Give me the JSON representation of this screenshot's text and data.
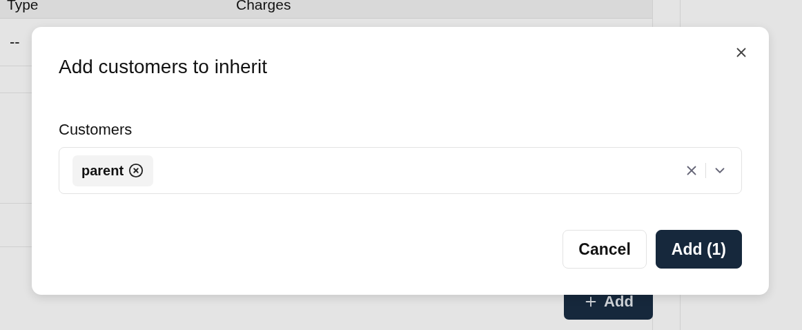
{
  "table": {
    "columns": [
      "Type",
      "Charges"
    ],
    "rows": [
      {
        "type": "--"
      }
    ]
  },
  "add_button": {
    "label": "Add"
  },
  "dialog": {
    "title": "Add customers to inherit",
    "field_label": "Customers",
    "selected": [
      {
        "label": "parent"
      }
    ],
    "buttons": [
      {
        "kind": "secondary",
        "label": "Cancel"
      },
      {
        "kind": "primary",
        "label": "Add (1)"
      }
    ]
  }
}
